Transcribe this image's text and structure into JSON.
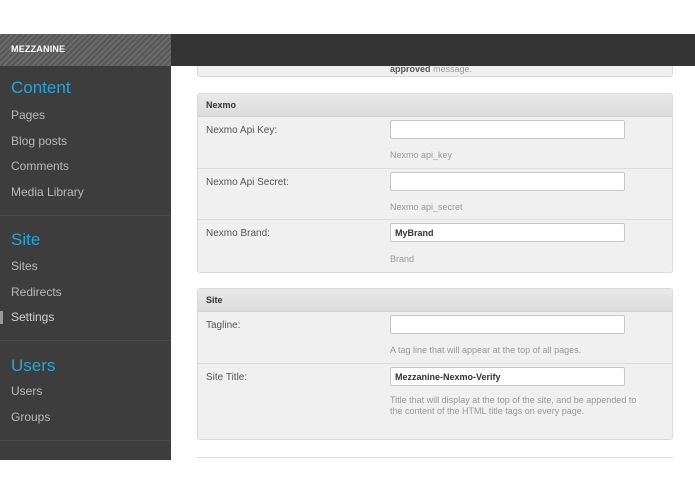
{
  "header": {
    "brand": "MEZZANINE"
  },
  "sidebar": {
    "sections": [
      {
        "title": "Content",
        "items": [
          "Pages",
          "Blog posts",
          "Comments",
          "Media Library"
        ]
      },
      {
        "title": "Site",
        "items": [
          "Sites",
          "Redirects",
          "Settings"
        ]
      },
      {
        "title": "Users",
        "items": [
          "Users",
          "Groups"
        ]
      }
    ],
    "active_item": "Settings"
  },
  "previous_panel": {
    "help_bold": "approved",
    "help_rest": "message."
  },
  "nexmo": {
    "title": "Nexmo",
    "api_key": {
      "label": "Nexmo Api Key:",
      "value": "",
      "help": "Nexmo api_key"
    },
    "api_secret": {
      "label": "Nexmo Api Secret:",
      "value": "",
      "help": "Nexmo api_secret"
    },
    "brand": {
      "label": "Nexmo Brand:",
      "value": "MyBrand",
      "help": "Brand"
    }
  },
  "site": {
    "title": "Site",
    "tagline": {
      "label": "Tagline:",
      "value": "",
      "help": "A tag line that will appear at the top of all pages."
    },
    "site_title": {
      "label": "Site Title:",
      "value": "Mezzanine-Nexmo-Verify",
      "help": "Title that will display at the top of the site, and be appended to the content of the HTML title tags on every page."
    }
  }
}
